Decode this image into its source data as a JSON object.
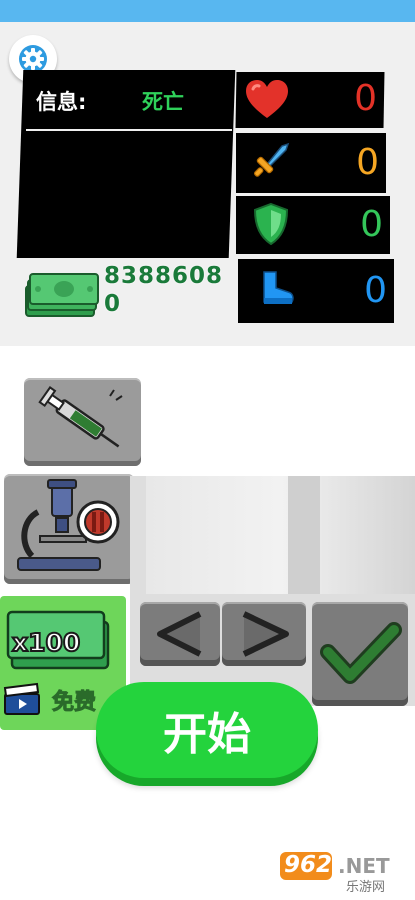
{
  "hud": {
    "info_label": "信息:",
    "info_value": "死亡",
    "money_line1": "8388608",
    "money_line2": "0",
    "stats": [
      {
        "icon": "heart-icon",
        "value": "0",
        "color": "#e33227"
      },
      {
        "icon": "sword-icon",
        "value": "0",
        "color": "#f5a623"
      },
      {
        "icon": "shield-icon",
        "value": "0",
        "color": "#34c65a"
      },
      {
        "icon": "boot-icon",
        "value": "0",
        "color": "#2196f3"
      }
    ]
  },
  "reward": {
    "multiplier": "x100",
    "free_label": "免费"
  },
  "start_label": "开始",
  "watermark": {
    "number": "962",
    "suffix": ".NET",
    "sub": "乐游网"
  },
  "colors": {
    "accent": "#58b7f0",
    "start": "#24d33d",
    "money": "#2f9e4d"
  }
}
